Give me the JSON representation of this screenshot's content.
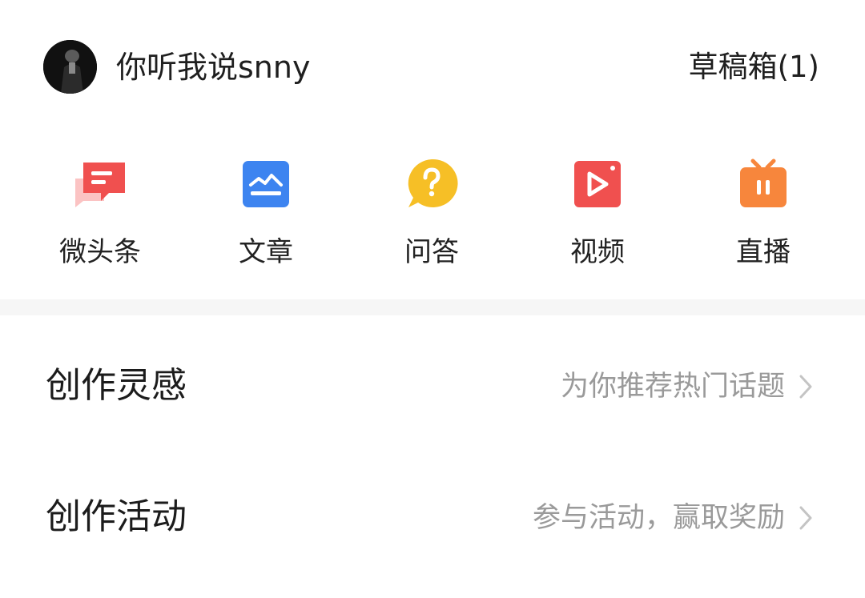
{
  "header": {
    "username": "你听我说snny",
    "drafts_label": "草稿箱(1)"
  },
  "shortcuts": [
    {
      "label": "微头条",
      "icon": "microheadline-chat-icon",
      "color": "#f0504f"
    },
    {
      "label": "文章",
      "icon": "article-chart-icon",
      "color": "#3d84f0"
    },
    {
      "label": "问答",
      "icon": "question-bubble-icon",
      "color": "#f6bf26"
    },
    {
      "label": "视频",
      "icon": "video-play-icon",
      "color": "#f0504f"
    },
    {
      "label": "直播",
      "icon": "live-tv-icon",
      "color": "#f7863c"
    }
  ],
  "rows": [
    {
      "title": "创作灵感",
      "subtitle": "为你推荐热门话题"
    },
    {
      "title": "创作活动",
      "subtitle": "参与活动，赢取奖励"
    }
  ]
}
